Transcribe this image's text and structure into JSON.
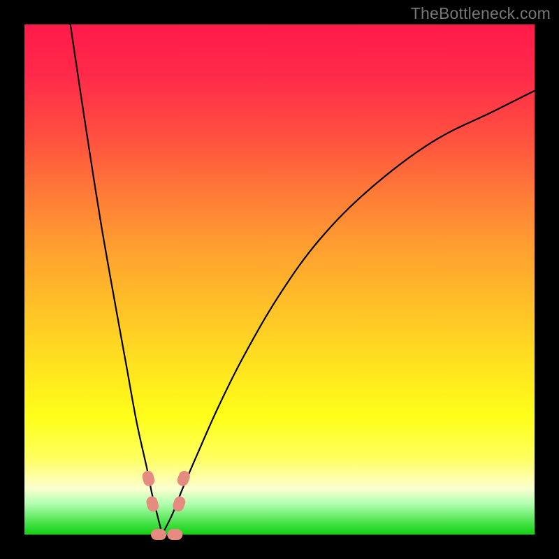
{
  "attribution": "TheBottleneck.com",
  "chart_data": {
    "type": "line",
    "title": "",
    "xlabel": "",
    "ylabel": "",
    "xlim": [
      0,
      100
    ],
    "ylim": [
      0,
      100
    ],
    "notch_x": 27,
    "series": [
      {
        "name": "left-arm",
        "x": [
          9,
          12,
          15,
          18,
          20,
          22,
          24,
          25,
          26,
          27
        ],
        "values": [
          100,
          80,
          61,
          44,
          33,
          22,
          13,
          8,
          4,
          0
        ]
      },
      {
        "name": "right-arm",
        "x": [
          27,
          29,
          31,
          34,
          38,
          43,
          50,
          58,
          68,
          80,
          92,
          100
        ],
        "values": [
          0,
          4,
          9,
          16,
          25,
          35,
          47,
          58,
          68,
          77,
          83,
          87
        ]
      }
    ],
    "markers": [
      {
        "name": "left-blob-upper",
        "x": 24.3,
        "y": 11
      },
      {
        "name": "left-blob-lower",
        "x": 25.1,
        "y": 6
      },
      {
        "name": "right-blob-upper",
        "x": 31.2,
        "y": 11
      },
      {
        "name": "right-blob-lower",
        "x": 30.3,
        "y": 6
      },
      {
        "name": "bottom-blob-left",
        "x": 26.3,
        "y": 0
      },
      {
        "name": "bottom-blob-right",
        "x": 29.5,
        "y": 0
      }
    ]
  }
}
